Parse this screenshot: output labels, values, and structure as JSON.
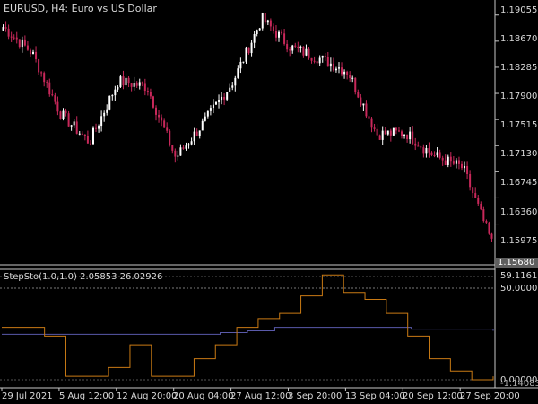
{
  "chart": {
    "symbol_title": "EURUSD, H4:  Euro vs US Dollar",
    "price_labels": [
      "1.19055",
      "1.18670",
      "1.18285",
      "1.17900",
      "1.17515",
      "1.17130",
      "1.16745",
      "1.16360",
      "1.15975"
    ],
    "current_price": "1.15680",
    "time_labels": [
      "29 Jul 2021",
      "5 Aug 12:00",
      "12 Aug 20:00",
      "20 Aug 04:00",
      "27 Aug 12:00",
      "3 Sep 20:00",
      "13 Sep 04:00",
      "20 Sep 12:00",
      "27 Sep 20:00"
    ],
    "colors": {
      "background": "#000000",
      "axis": "#c8c8c8",
      "bull_candle": "#ffffff",
      "bear_candle": "#c8285a"
    }
  },
  "indicator": {
    "title": "StepSto(1.0,1.0) 2.05853 26.02926",
    "scale_labels": [
      "59.11611",
      "50.00000",
      "0.00000"
    ],
    "scale_label_overlap": "-1.14083",
    "colors": {
      "fast_line": "#c97a14",
      "slow_line": "#5a5aaa",
      "level_line": "#7a7a7a"
    }
  },
  "chart_data": {
    "type": "line",
    "x": [
      "29 Jul 2021",
      "5 Aug 12:00",
      "12 Aug 20:00",
      "20 Aug 04:00",
      "27 Aug 12:00",
      "3 Sep 20:00",
      "13 Sep 04:00",
      "20 Sep 12:00",
      "27 Sep 20:00"
    ],
    "price_series": {
      "name": "EURUSD H4",
      "close_approx": [
        1.1888,
        1.185,
        1.176,
        1.1718,
        1.1808,
        1.18,
        1.1695,
        1.1748,
        1.1808,
        1.19,
        1.1858,
        1.1842,
        1.1822,
        1.173,
        1.1732,
        1.1698,
        1.168,
        1.157
      ]
    },
    "indicator_series": [
      {
        "name": "StepSto",
        "values_approx": [
          30,
          30,
          25,
          2,
          2,
          7,
          20,
          2,
          2,
          12,
          20,
          30,
          35,
          38,
          48,
          60,
          50,
          46,
          38,
          25,
          12,
          5,
          0,
          2
        ]
      },
      {
        "name": "StepSto",
        "values_approx": [
          26,
          26,
          26,
          26,
          26,
          26,
          26,
          26,
          27,
          28,
          30,
          30,
          30,
          30,
          30,
          29,
          29,
          29,
          28
        ]
      }
    ],
    "levels": [
      50.0
    ],
    "y_range_price": [
      1.154,
      1.1925
    ],
    "y_range_indicator": [
      -1.14083,
      59.11611
    ],
    "grid": false
  }
}
